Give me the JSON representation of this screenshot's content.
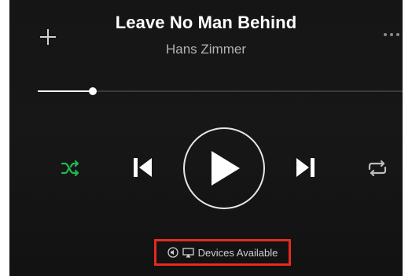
{
  "track": {
    "title": "Leave No Man Behind",
    "artist": "Hans Zimmer"
  },
  "playback": {
    "progress": 0.15,
    "state": "paused",
    "shuffle_enabled": true,
    "repeat_enabled": false
  },
  "icons": {
    "add": "plus-icon",
    "more": "more-icon",
    "shuffle": "shuffle-icon",
    "previous": "skip-previous-icon",
    "play": "play-icon",
    "next": "skip-next-icon",
    "repeat": "repeat-icon",
    "speaker": "speaker-icon",
    "airplay": "airplay-icon"
  },
  "devices": {
    "label": "Devices Available"
  },
  "colors": {
    "accent_green": "#1db954",
    "highlight_box": "#e8281e"
  }
}
